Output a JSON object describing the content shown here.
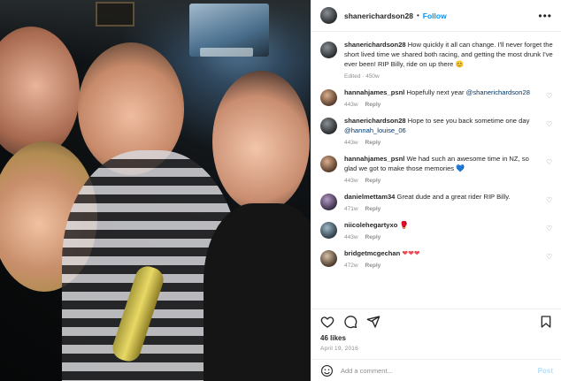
{
  "post": {
    "username": "shanerichardson28",
    "follow_label": "Follow",
    "separator": "•",
    "more_label": "•••",
    "caption": {
      "username": "shanerichardson28",
      "text": "How quickly it all can change. I'll never forget the short lived time we shared both racing, and getting the most drunk I've ever been! RIP Billy, ride on up there",
      "emoji": "😊",
      "meta": "Edited · 450w"
    },
    "likes": "46 likes",
    "date": "April 19, 2016"
  },
  "comments": [
    {
      "username": "hannahjames_psnl",
      "text": "Hopefully next year",
      "mention": "@shanerichardson28",
      "age": "443w",
      "reply": "Reply"
    },
    {
      "username": "shanerichardson28",
      "text": "Hope to see you back sometime one day",
      "mention": "@hannah_louise_06",
      "age": "443w",
      "reply": "Reply"
    },
    {
      "username": "hannahjames_psnl",
      "text": "We had such an awesome time in NZ, so glad we got to make those memories",
      "emoji": "💙",
      "age": "443w",
      "reply": "Reply"
    },
    {
      "username": "danielmettam34",
      "text": "Great dude and a great rider RIP Billy.",
      "age": "471w",
      "reply": "Reply"
    },
    {
      "username": "niicolehegartyxo",
      "text": "",
      "emoji": "🥊",
      "age": "443w",
      "reply": "Reply"
    },
    {
      "username": "bridgetmcgechan",
      "text": "",
      "emoji": "❤❤❤",
      "age": "472w",
      "reply": "Reply"
    }
  ],
  "add_comment": {
    "placeholder": "Add a comment...",
    "post_label": "Post"
  },
  "icons": {
    "like": "heart-icon",
    "comment": "comment-icon",
    "share": "share-icon",
    "save": "bookmark-icon",
    "emoji": "smiley-icon",
    "comment_like": "heart-outline-icon"
  },
  "colors": {
    "accent": "#0095f6",
    "muted": "#8e8e8e",
    "mention": "#00376b"
  }
}
